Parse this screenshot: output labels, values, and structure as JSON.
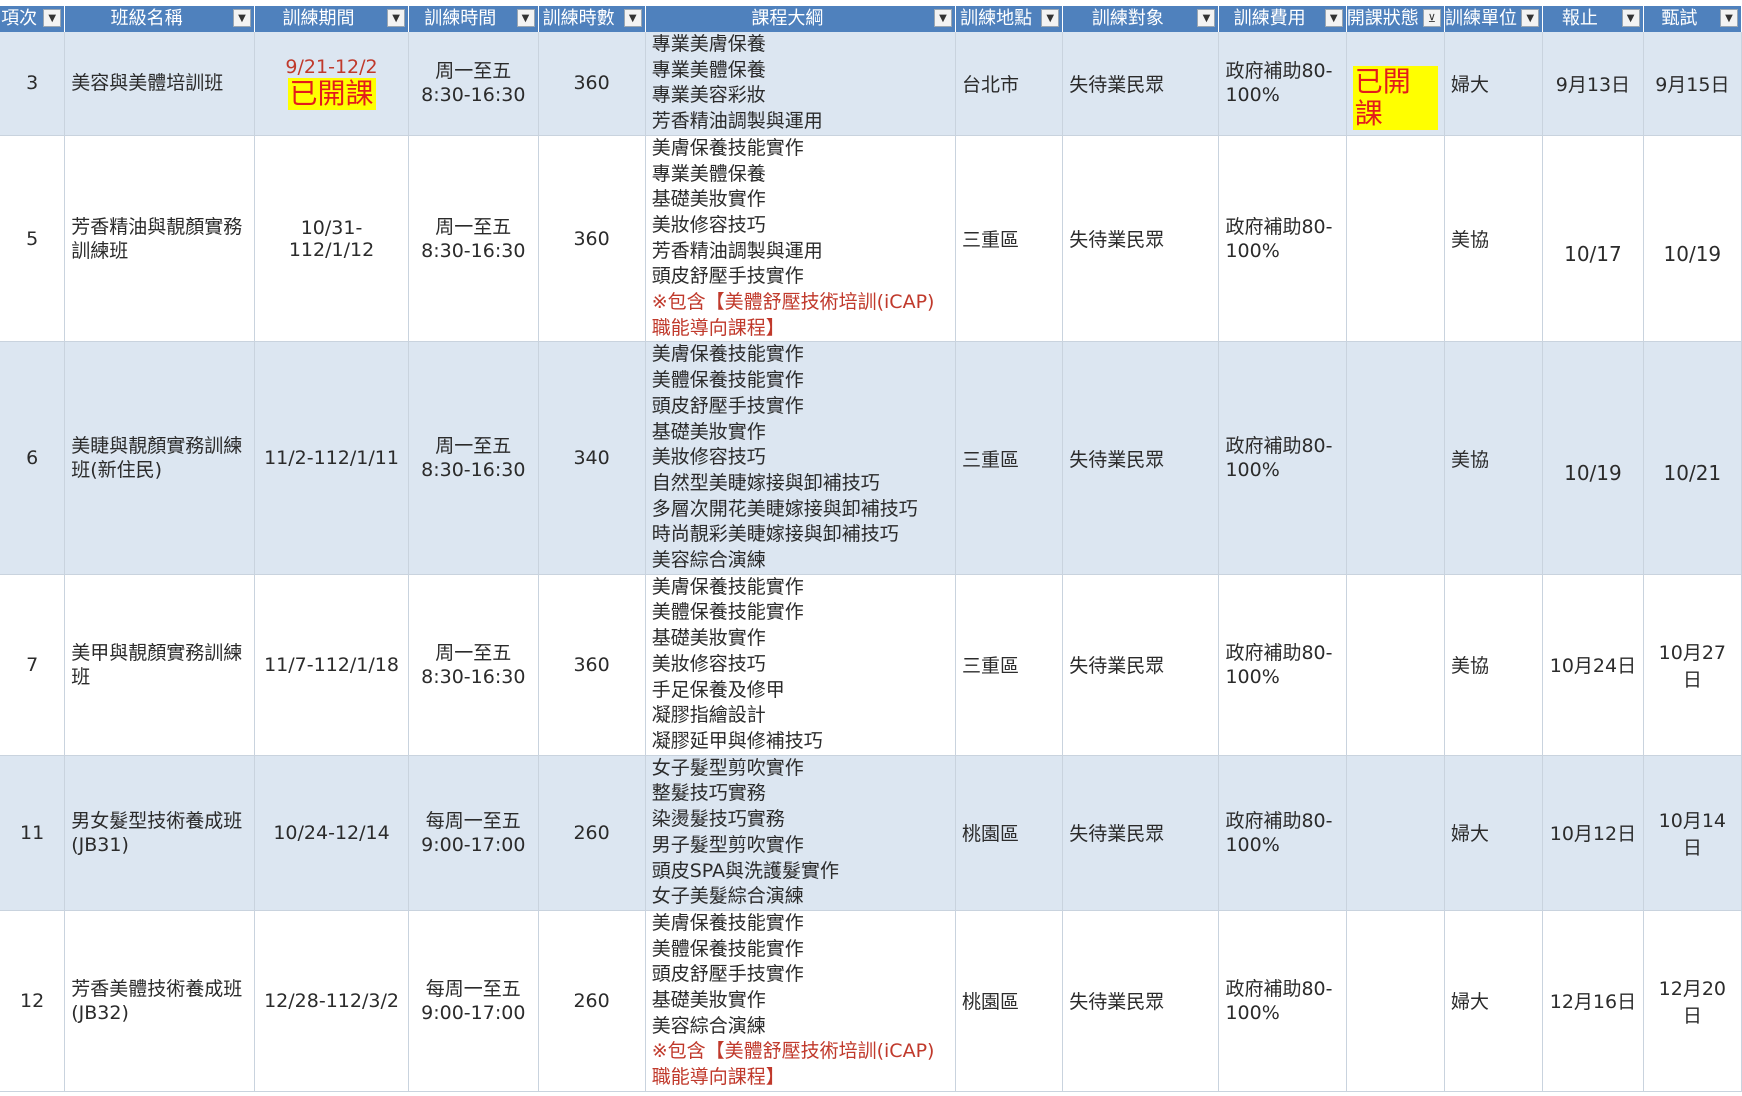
{
  "columns": [
    {
      "label": "項次",
      "filtered": false
    },
    {
      "label": "班級名稱",
      "filtered": false
    },
    {
      "label": "訓練期間",
      "filtered": false
    },
    {
      "label": "訓練時間",
      "filtered": false
    },
    {
      "label": "訓練時數",
      "filtered": false
    },
    {
      "label": "課程大綱",
      "filtered": false
    },
    {
      "label": "訓練地點",
      "filtered": false
    },
    {
      "label": "訓練對象",
      "filtered": false
    },
    {
      "label": "訓練費用",
      "filtered": false
    },
    {
      "label": "開課狀態",
      "filtered": true
    },
    {
      "label": "訓練單位",
      "filtered": false
    },
    {
      "label": "報止",
      "filtered": false
    },
    {
      "label": "甄試",
      "filtered": false
    }
  ],
  "rows": [
    {
      "no": "3",
      "name": [
        "美容與美體培訓班"
      ],
      "period": "9/21-12/2",
      "period_badge": "已開課",
      "time": [
        "周一至五",
        "8:30-16:30"
      ],
      "hours": "360",
      "outline": [
        {
          "text": "專業美膚保養",
          "red": false
        },
        {
          "text": "專業美體保養",
          "red": false
        },
        {
          "text": "專業美容彩妝",
          "red": false
        },
        {
          "text": "芳香精油調製與運用",
          "red": false
        }
      ],
      "location": "台北市",
      "target": "失待業民眾",
      "fee": [
        "政府補助80-",
        "100%"
      ],
      "status": "已開課",
      "unit": "婦大",
      "signup_end": "9月13日",
      "exam": "9月15日"
    },
    {
      "no": "5",
      "name": [
        "芳香精油與靚顏實務",
        "訓練班"
      ],
      "period": "10/31-112/1/12",
      "period_badge": "",
      "time": [
        "周一至五",
        "8:30-16:30"
      ],
      "hours": "360",
      "outline": [
        {
          "text": "美膚保養技能實作",
          "red": false
        },
        {
          "text": "專業美體保養",
          "red": false
        },
        {
          "text": "基礎美妝實作",
          "red": false
        },
        {
          "text": "美妝修容技巧",
          "red": false
        },
        {
          "text": "芳香精油調製與運用",
          "red": false
        },
        {
          "text": "頭皮舒壓手技實作",
          "red": false
        },
        {
          "text": "※包含【美體舒壓技術培訓(iCAP)",
          "red": true
        },
        {
          "text": "職能導向課程】",
          "red": true
        }
      ],
      "location": "三重區",
      "target": "失待業民眾",
      "fee": [
        "政府補助80-",
        "100%"
      ],
      "status": "",
      "unit": "美協",
      "signup_end": "10/17",
      "exam": "10/19"
    },
    {
      "no": "6",
      "name": [
        "美睫與靚顏實務訓練",
        "班(新住民)"
      ],
      "period": "11/2-112/1/11",
      "period_badge": "",
      "time": [
        "周一至五",
        "8:30-16:30"
      ],
      "hours": "340",
      "outline": [
        {
          "text": "美膚保養技能實作",
          "red": false
        },
        {
          "text": "美體保養技能實作",
          "red": false
        },
        {
          "text": "頭皮舒壓手技實作",
          "red": false
        },
        {
          "text": "基礎美妝實作",
          "red": false
        },
        {
          "text": "美妝修容技巧",
          "red": false
        },
        {
          "text": "自然型美睫嫁接與卸補技巧",
          "red": false
        },
        {
          "text": "多層次開花美睫嫁接與卸補技巧",
          "red": false
        },
        {
          "text": "時尚靚彩美睫嫁接與卸補技巧",
          "red": false
        },
        {
          "text": "美容綜合演練",
          "red": false
        }
      ],
      "location": "三重區",
      "target": "失待業民眾",
      "fee": [
        "政府補助80-",
        "100%"
      ],
      "status": "",
      "unit": "美協",
      "signup_end": "10/19",
      "exam": "10/21"
    },
    {
      "no": "7",
      "name": [
        "美甲與靚顏實務訓練",
        "班"
      ],
      "period": "11/7-112/1/18",
      "period_badge": "",
      "time": [
        "周一至五",
        "8:30-16:30"
      ],
      "hours": "360",
      "outline": [
        {
          "text": "美膚保養技能實作",
          "red": false
        },
        {
          "text": "美體保養技能實作",
          "red": false
        },
        {
          "text": "基礎美妝實作",
          "red": false
        },
        {
          "text": "美妝修容技巧",
          "red": false
        },
        {
          "text": "手足保養及修甲",
          "red": false
        },
        {
          "text": "凝膠指繪設計",
          "red": false
        },
        {
          "text": "凝膠延甲與修補技巧",
          "red": false
        }
      ],
      "location": "三重區",
      "target": "失待業民眾",
      "fee": [
        "政府補助80-",
        "100%"
      ],
      "status": "",
      "unit": "美協",
      "signup_end": "10月24日",
      "exam": "10月27日"
    },
    {
      "no": "11",
      "name": [
        "男女髮型技術養成班",
        "(JB31)"
      ],
      "period": "10/24-12/14",
      "period_badge": "",
      "time": [
        "每周一至五",
        "9:00-17:00"
      ],
      "hours": "260",
      "outline": [
        {
          "text": "女子髮型剪吹實作",
          "red": false
        },
        {
          "text": "整髮技巧實務",
          "red": false
        },
        {
          "text": "染燙髮技巧實務",
          "red": false
        },
        {
          "text": "男子髮型剪吹實作",
          "red": false
        },
        {
          "text": "頭皮SPA與洗護髮實作",
          "red": false
        },
        {
          "text": "女子美髮綜合演練",
          "red": false
        }
      ],
      "location": "桃園區",
      "target": "失待業民眾",
      "fee": [
        "政府補助80-",
        "100%"
      ],
      "status": "",
      "unit": "婦大",
      "signup_end": "10月12日",
      "exam": "10月14日"
    },
    {
      "no": "12",
      "name": [
        "芳香美體技術養成班",
        "(JB32)"
      ],
      "period": "12/28-112/3/2",
      "period_badge": "",
      "time": [
        "每周一至五",
        "9:00-17:00"
      ],
      "hours": "260",
      "outline": [
        {
          "text": "美膚保養技能實作",
          "red": false
        },
        {
          "text": "美體保養技能實作",
          "red": false
        },
        {
          "text": "頭皮舒壓手技實作",
          "red": false
        },
        {
          "text": "基礎美妝實作",
          "red": false
        },
        {
          "text": "美容綜合演練",
          "red": false
        },
        {
          "text": "※包含【美體舒壓技術培訓(iCAP)",
          "red": true
        },
        {
          "text": "職能導向課程】",
          "red": true
        }
      ],
      "location": "桃園區",
      "target": "失待業民眾",
      "fee": [
        "政府補助80-",
        "100%"
      ],
      "status": "",
      "unit": "婦大",
      "signup_end": "12月16日",
      "exam": "12月20日"
    }
  ]
}
